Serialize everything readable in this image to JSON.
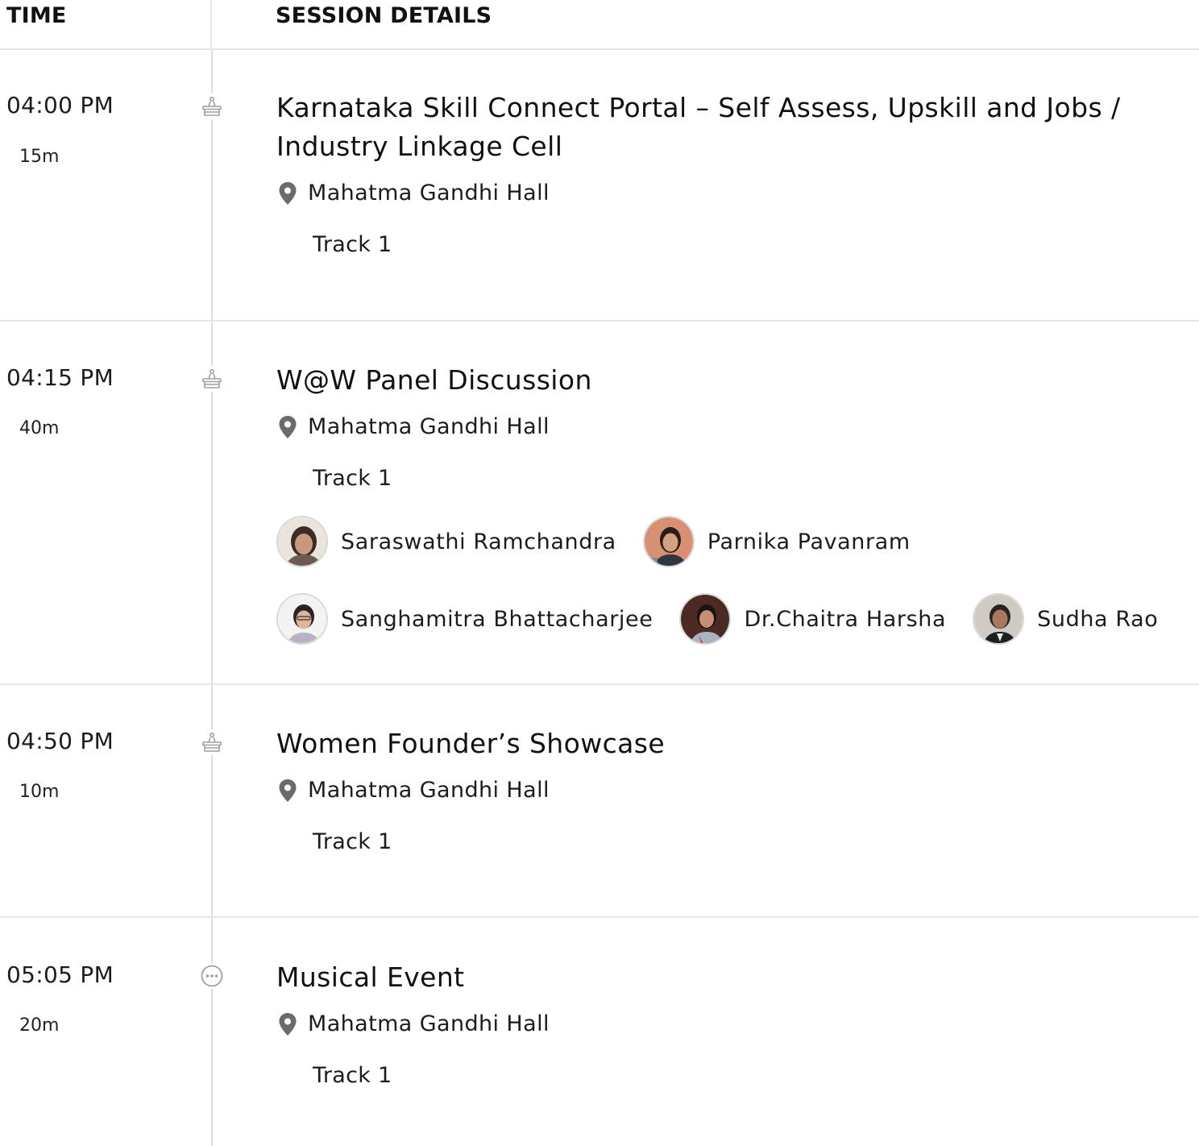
{
  "header": {
    "time_label": "TIME",
    "details_label": "SESSION DETAILS"
  },
  "sessions": [
    {
      "time": "04:00 PM",
      "duration": "15m",
      "type_icon": "podium-icon",
      "title": "Karnataka Skill Connect Portal – Self Assess, Upskill and Jobs / Industry Linkage Cell",
      "location": "Mahatma Gandhi Hall",
      "track": "Track 1",
      "speakers": []
    },
    {
      "time": "04:15 PM",
      "duration": "40m",
      "type_icon": "podium-icon",
      "title": "W@W Panel Discussion",
      "location": "Mahatma Gandhi Hall",
      "track": "Track 1",
      "speakers": [
        {
          "name": "Saraswathi Ramchandra"
        },
        {
          "name": "Parnika Pavanram"
        },
        {
          "name": "Sanghamitra Bhattacharjee"
        },
        {
          "name": "Dr.Chaitra Harsha"
        },
        {
          "name": "Sudha Rao"
        }
      ]
    },
    {
      "time": "04:50 PM",
      "duration": "10m",
      "type_icon": "podium-icon",
      "title": "Women Founder’s Showcase",
      "location": "Mahatma Gandhi Hall",
      "track": "Track 1",
      "speakers": []
    },
    {
      "time": "05:05 PM",
      "duration": "20m",
      "type_icon": "more-circle-icon",
      "title": "Musical Event",
      "location": "Mahatma Gandhi Hall",
      "track": "Track 1",
      "speakers": []
    }
  ],
  "colors": {
    "text": "#1c1c1c",
    "divider": "#e6e6e6",
    "icon": "#9e9e9e",
    "pin": "#6b6b6b"
  }
}
